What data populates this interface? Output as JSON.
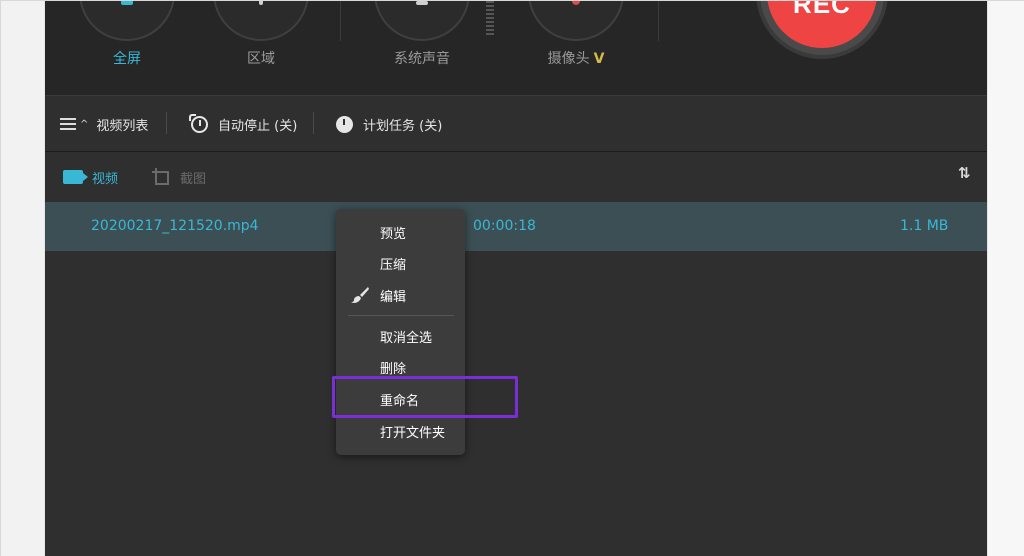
{
  "modes": {
    "fullscreen": "全屏",
    "region": "区域",
    "system_audio": "系统声音",
    "camera": "摄像头",
    "camera_chevron": "V"
  },
  "rec_button": "REC",
  "toolbar": {
    "video_list": "视频列表",
    "auto_stop": "自动停止 (关)",
    "scheduled_task": "计划任务 (关)"
  },
  "tabs": {
    "video": "视频",
    "screenshot": "截图"
  },
  "sort_icon": "⇅",
  "file_row": {
    "name": "20200217_121520.mp4",
    "duration": "00:00:18",
    "size": "1.1 MB"
  },
  "context_menu": {
    "preview": "预览",
    "compress": "压缩",
    "edit": "编辑",
    "deselect_all": "取消全选",
    "delete": "删除",
    "rename": "重命名",
    "open_folder": "打开文件夹"
  },
  "colors": {
    "accent": "#39b8d6",
    "rec_red": "#ef4444",
    "highlight": "#7a2fd6",
    "camera_chevron": "#d6b84a"
  }
}
